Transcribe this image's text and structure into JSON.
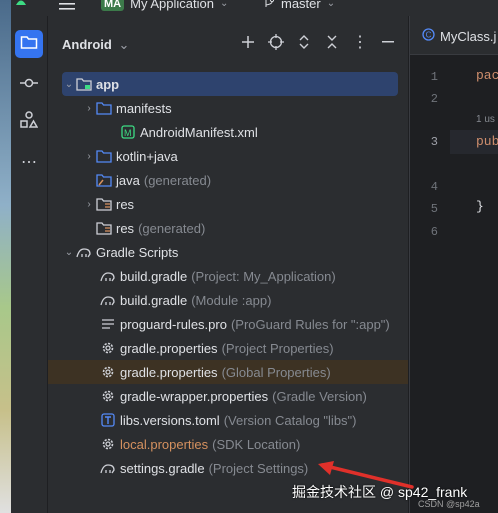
{
  "titlebar": {
    "project_badge": "MA",
    "project_name": "My Application",
    "branch": "master"
  },
  "panel": {
    "title": "Android"
  },
  "tree": [
    {
      "label": "app",
      "hint": "",
      "bold": true
    },
    {
      "label": "manifests",
      "hint": ""
    },
    {
      "label": "AndroidManifest.xml",
      "hint": ""
    },
    {
      "label": "kotlin+java",
      "hint": ""
    },
    {
      "label": "java",
      "hint": "(generated)"
    },
    {
      "label": "res",
      "hint": ""
    },
    {
      "label": "res",
      "hint": "(generated)"
    },
    {
      "label": "Gradle Scripts",
      "hint": ""
    },
    {
      "label": "build.gradle",
      "hint": "(Project: My_Application)"
    },
    {
      "label": "build.gradle",
      "hint": "(Module :app)"
    },
    {
      "label": "proguard-rules.pro",
      "hint": "(ProGuard Rules for \":app\")"
    },
    {
      "label": "gradle.properties",
      "hint": "(Project Properties)"
    },
    {
      "label": "gradle.properties",
      "hint": "(Global Properties)"
    },
    {
      "label": "gradle-wrapper.properties",
      "hint": "(Gradle Version)"
    },
    {
      "label": "libs.versions.toml",
      "hint": "(Version Catalog \"libs\")"
    },
    {
      "label": "local.properties",
      "hint": "(SDK Location)"
    },
    {
      "label": "settings.gradle",
      "hint": "(Project Settings)"
    }
  ],
  "editor": {
    "tab_label": "MyClass.j",
    "line_numbers": [
      "1",
      "2",
      "3",
      "4",
      "5",
      "6"
    ],
    "code_fragments": [
      "pac",
      "1 us",
      "pub",
      "}"
    ]
  },
  "watermark": {
    "text": "掘金技术社区 @ sp42_frank",
    "csdn": "CSDN @sp42a"
  },
  "colors": {
    "accent": "#3574f0",
    "selection": "#2e436e",
    "highlight": "#3d3223",
    "modified_file": "#d5915f",
    "hint": "#868a91",
    "keyword": "#cf8e6d"
  }
}
